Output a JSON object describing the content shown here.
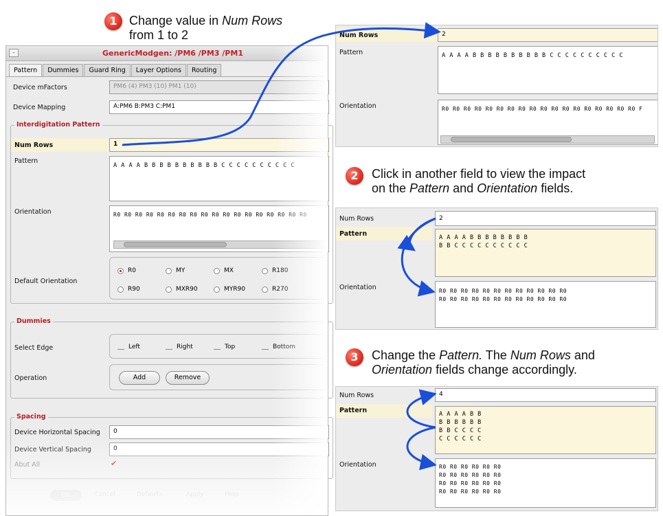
{
  "dialog": {
    "title": "GenericModgen: /PM6 /PM3 /PM1",
    "tabs": [
      "Pattern",
      "Dummies",
      "Guard Ring",
      "Layer Options",
      "Routing"
    ],
    "device_mfactors_label": "Device mFactors",
    "device_mfactors_value": "PM6 (4) PM3 (10) PM1 (10)",
    "device_mapping_label": "Device Mapping",
    "device_mapping_value": "A:PM6 B:PM3 C:PM1",
    "interdigitation": {
      "title": "Interdigitation Pattern",
      "num_rows_label": "Num Rows",
      "num_rows_value": "1",
      "pattern_label": "Pattern",
      "pattern_value": "A A A A B B B B B B B B B B C C C C C C C C C C",
      "orientation_label": "Orientation",
      "orientation_value": "R0 R0 R0 R0 R0 R0 R0 R0 R0 R0 R0 R0 R0 R0 R0 R0 R0 R0",
      "default_orientation_label": "Default Orientation",
      "orientations": [
        "R0",
        "MY",
        "MX",
        "R180",
        "R90",
        "MXR90",
        "MYR90",
        "R270"
      ],
      "selected_orientation": "R0"
    },
    "dummies": {
      "title": "Dummies",
      "select_edge_label": "Select Edge",
      "edges": [
        "Left",
        "Right",
        "Top",
        "Bottom"
      ],
      "operation_label": "Operation",
      "add_label": "Add",
      "remove_label": "Remove"
    },
    "spacing": {
      "title": "Spacing",
      "horizontal_label": "Device Horizontal Spacing",
      "horizontal_value": "0",
      "vertical_label": "Device Vertical Spacing",
      "vertical_value": "0",
      "abut_label": "Abut All",
      "abut_mark": "✔"
    },
    "footer": [
      "OK",
      "Cancel",
      "Defaults",
      "Apply",
      "Help"
    ]
  },
  "steps": [
    {
      "number": "1",
      "line1": "Change value in ",
      "line1_em": "Num Rows",
      "line2": "from 1 to  2"
    },
    {
      "number": "2",
      "line1": "Click in another field to view the impact",
      "line2_pre": "on the ",
      "line2_em1": "Pattern",
      "line2_mid": " and ",
      "line2_em2": "Orientation",
      "line2_post": " fields."
    },
    {
      "number": "3",
      "line1_pre": "Change the ",
      "line1_em1": "Pattern.",
      "line1_mid": " The ",
      "line1_em2": "Num Rows",
      "line1_post": " and",
      "line2_em": "Orientation",
      "line2_post": " fields change accordingly."
    }
  ],
  "panel1": {
    "num_rows_label": "Num Rows",
    "num_rows_value": "2",
    "pattern_label": "Pattern",
    "pattern_value": "A A A A B B B B B B B B B B C C C C C C C C C C",
    "orientation_label": "Orientation",
    "orientation_value": "R0 R0 R0 R0 R0 R0 R0 R0 R0 R0 R0 R0 R0 R0 R0 R0 R0 R0 F"
  },
  "panel2": {
    "num_rows_label": "Num Rows",
    "num_rows_value": "2",
    "pattern_label": "Pattern",
    "pattern_value": "A A A A B B B B B B B B\nB B C C C C C C C C C C",
    "orientation_label": "Orientation",
    "orientation_value": "R0 R0 R0 R0 R0 R0 R0 R0 R0 R0 R0 R0\nR0 R0 R0 R0 R0 R0 R0 R0 R0 R0 R0 R0"
  },
  "panel3": {
    "num_rows_label": "Num Rows",
    "num_rows_value": "4",
    "pattern_label": "Pattern",
    "pattern_value": "A A A A B B\nB B B B B B\nB B C C C C\nC C C C C C",
    "orientation_label": "Orientation",
    "orientation_value": "R0 R0 R0 R0 R0 R0\nR0 R0 R0 R0 R0 R0\nR0 R0 R0 R0 R0 R0\nR0 R0 R0 R0 R0 R0"
  },
  "colors": {
    "accent": "#c0202a",
    "arrow": "#1a4fd8",
    "highlight": "#fbf6dc"
  }
}
